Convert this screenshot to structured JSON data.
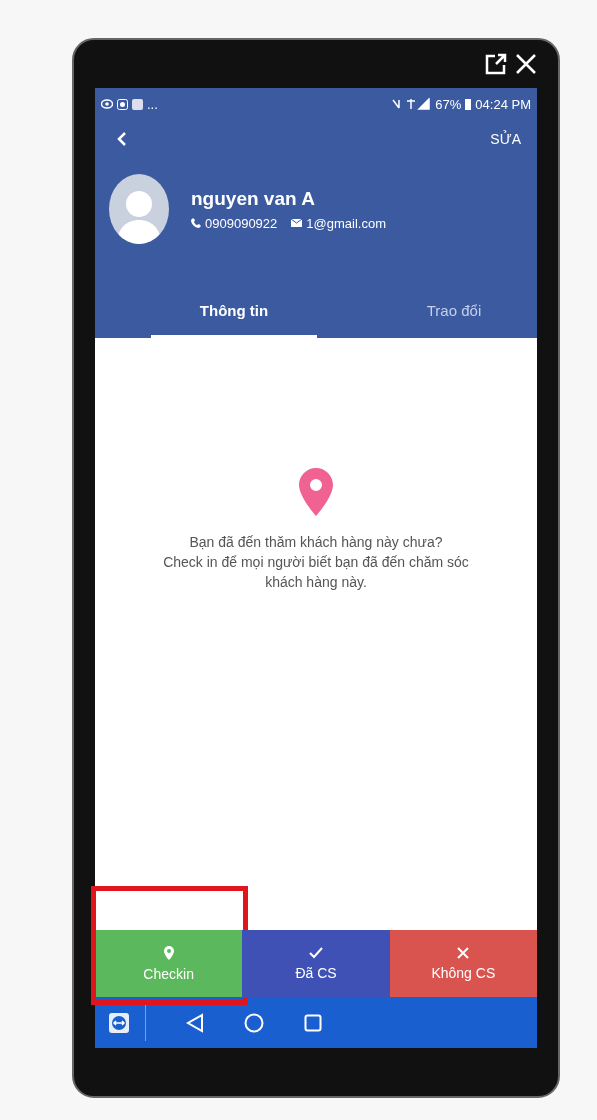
{
  "status_bar": {
    "notifications": "...",
    "battery": "67%",
    "time": "04:24 PM"
  },
  "toolbar": {
    "edit": "SỬA"
  },
  "profile": {
    "name": "nguyen van A",
    "phone": "0909090922",
    "email": "1@gmail.com"
  },
  "tabs": [
    {
      "label": "Thông tin",
      "selected": true
    },
    {
      "label": "Trao đổi",
      "selected": false
    }
  ],
  "message": [
    "Bạn đã đến thăm khách hàng này chưa?",
    "Check in để mọi người biết bạn đã đến chăm sóc",
    "khách hàng này."
  ],
  "actions": [
    {
      "kind": "pin",
      "label": "Checkin",
      "color": "#5cb85c",
      "highlighted": true
    },
    {
      "kind": "check",
      "label": "Đã CS",
      "color": "#3f51b5",
      "highlighted": false
    },
    {
      "kind": "cross",
      "label": "Không CS",
      "color": "#d9534f",
      "highlighted": false
    }
  ]
}
